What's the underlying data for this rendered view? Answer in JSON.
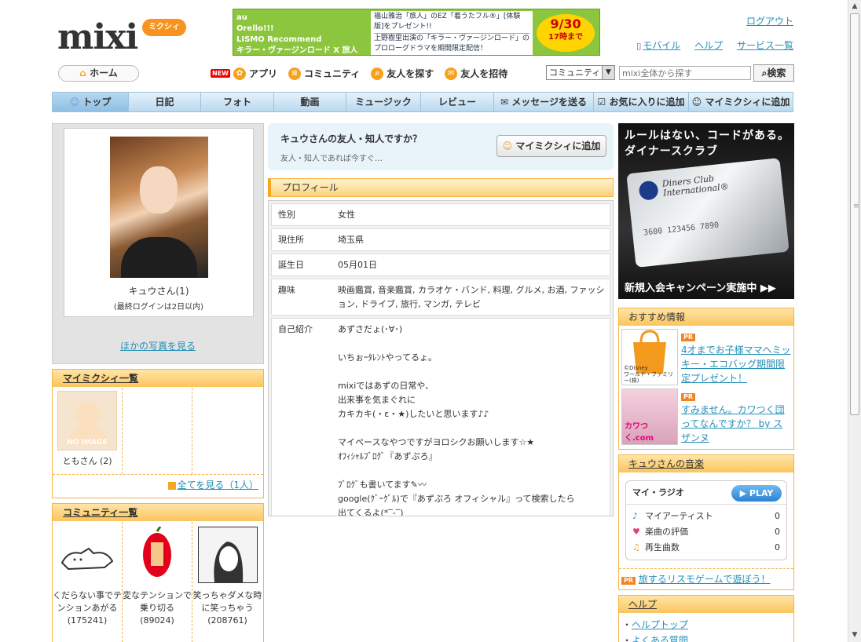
{
  "header": {
    "logo": "mixi",
    "logo_sub": "ミクシィ",
    "logout": "ログアウト",
    "links": [
      "モバイル",
      "ヘルプ",
      "サービス一覧"
    ]
  },
  "banner": {
    "left": "au\nOrello!!!\nLISMO Recommend\nキラー・ヴァージンロード X 旅人",
    "mid1": "福山雅治「旅人」のEZ「着うたフル®」[体験版]をプレゼント!!",
    "mid2": "上野樹里出演の「キラー・ヴァージンロード」のプロローグドラマを期間限定配信！",
    "date": "9/30",
    "date_sub": "17時まで"
  },
  "subnav": {
    "home": "ホーム",
    "new_badge": "NEW",
    "items": [
      "アプリ",
      "コミュニティ",
      "友人を探す",
      "友人を招待"
    ],
    "search_select": "コミュニティ",
    "search_placeholder": "mixi全体から探す",
    "search_button": "検索"
  },
  "mainnav": [
    "トップ",
    "日記",
    "フォト",
    "動画",
    "ミュージック",
    "レビュー",
    "メッセージを送る",
    "お気に入りに追加",
    "マイミクシィに追加"
  ],
  "profile": {
    "name": "キュウさん(1)",
    "last_login": "(最終ログインは2日以内)",
    "more_photos": "ほかの写真を見る"
  },
  "mymixi": {
    "title": "マイミクシィ一覧",
    "noimage": "NO IMAGE",
    "friend": "ともさん (2)",
    "view_all": "全てを見る（1人）"
  },
  "community": {
    "title": "コミュニティ一覧",
    "items": [
      "くだらない事でテンションあがる (175241)",
      "変なテンションで乗り切る (89024)",
      "笑っちゃダメな時に笑っちゃう (208761)"
    ]
  },
  "friend_prompt": {
    "question": "キュウさんの友人・知人ですか？",
    "sub": "友人・知人であれば今すぐ…",
    "button": "マイミクシィに追加"
  },
  "profile_table": {
    "title": "プロフィール",
    "rows": [
      {
        "k": "性別",
        "v": "女性"
      },
      {
        "k": "現住所",
        "v": "埼玉県"
      },
      {
        "k": "誕生日",
        "v": "05月01日"
      },
      {
        "k": "趣味",
        "v": "映画鑑賞, 音楽鑑賞, カラオケ・バンド, 料理, グルメ, お酒, ファッション, ドライブ, 旅行, マンガ, テレビ"
      },
      {
        "k": "自己紹介",
        "v": "あずさだょ(･∀･)\n\nいちぉｰﾀﾚﾝﾄやってるょ。\n\nmixiではあずの日常や、\n出来事を気まぐれに\nカキカキ(・ε・★)したいと思います♪♪\n\nマイペースなやつですがヨロシクお願いします☆★\nｵﾌｨｼｬﾙﾌﾞﾛｸﾞ『あずぷろ』\n\nﾌﾞﾛｸﾞも書いてます✎〰\ngoogle(ｸﾞｰｸﾞﾙ)で『あずぷろ オフィシャル』って検索したら\n出てくるよ(*‾-‾)\n\n仕事は東京だけど、\n住みは埼玉県なので、埼玉県の方は覗いてってくださいネ"
      }
    ]
  },
  "diners_ad": {
    "line1": "ルールはない、コードがある。",
    "line2": "ダイナースクラブ",
    "card_brand": "Diners Club International®",
    "card_number": "3600 123456 7890",
    "footer": "新規入会キャンペーン実施中 ▶▶"
  },
  "recommend": {
    "title": "おすすめ情報",
    "pr": "PR",
    "items": [
      {
        "text": "4才までお子様ママへミッキー・エコバッグ期間限定プレゼント！",
        "img_caption": "©Disney\nワールド・ファミリー(株)"
      },
      {
        "text": "すみません。カワつく団ってなんですか？ by スザンヌ",
        "img_caption": "カワつく.com"
      }
    ]
  },
  "music": {
    "title": "キュウさんの音楽",
    "radio": "マイ・ラジオ",
    "play": "▶ PLAY",
    "rows": [
      {
        "label": "マイアーティスト",
        "count": "0"
      },
      {
        "label": "楽曲の評価",
        "count": "0"
      },
      {
        "label": "再生曲数",
        "count": "0"
      }
    ],
    "pr_link": "旅するリスモゲームで遊ぼう！"
  },
  "help": {
    "title": "ヘルプ",
    "items": [
      "ヘルプトップ",
      "よくある質問"
    ]
  },
  "colors": {
    "accent_orange": "#f6b34a",
    "link_blue": "#258fb8",
    "nav_blue": "#b9d9ef"
  }
}
